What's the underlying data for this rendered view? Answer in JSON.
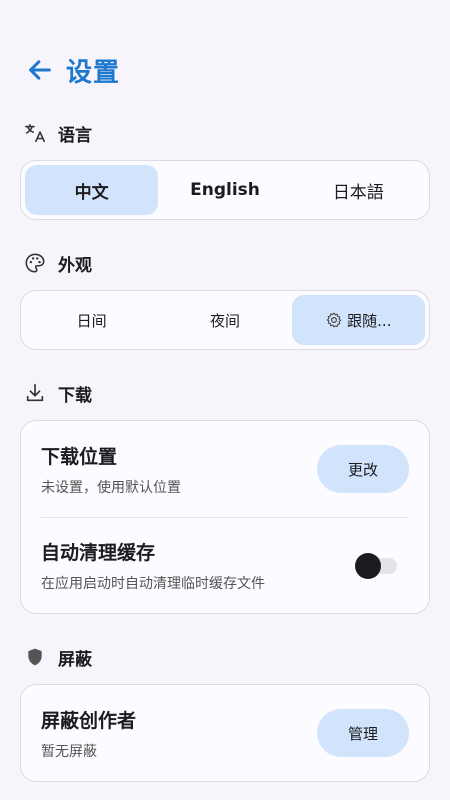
{
  "header": {
    "title": "设置"
  },
  "language": {
    "title": "语言",
    "options": [
      "中文",
      "English",
      "日本語"
    ],
    "selected": 0
  },
  "appearance": {
    "title": "外观",
    "options": [
      "日间",
      "夜间",
      "跟随..."
    ],
    "selected": 2
  },
  "download": {
    "title": "下载",
    "location": {
      "title": "下载位置",
      "subtitle": "未设置，使用默认位置",
      "button": "更改"
    },
    "cache": {
      "title": "自动清理缓存",
      "subtitle": "在应用启动时自动清理临时缓存文件",
      "enabled": false
    }
  },
  "block": {
    "title": "屏蔽",
    "creators": {
      "title": "屏蔽创作者",
      "subtitle": "暂无屏蔽",
      "button": "管理"
    }
  },
  "colors": {
    "accent": "#1e78d0",
    "selected_bg": "#d2e4fb"
  },
  "icons": {
    "back": "arrow-left-icon",
    "language": "translate-icon",
    "appearance": "palette-icon",
    "download": "download-icon",
    "block": "shield-icon",
    "follow_system": "gear-icon"
  }
}
